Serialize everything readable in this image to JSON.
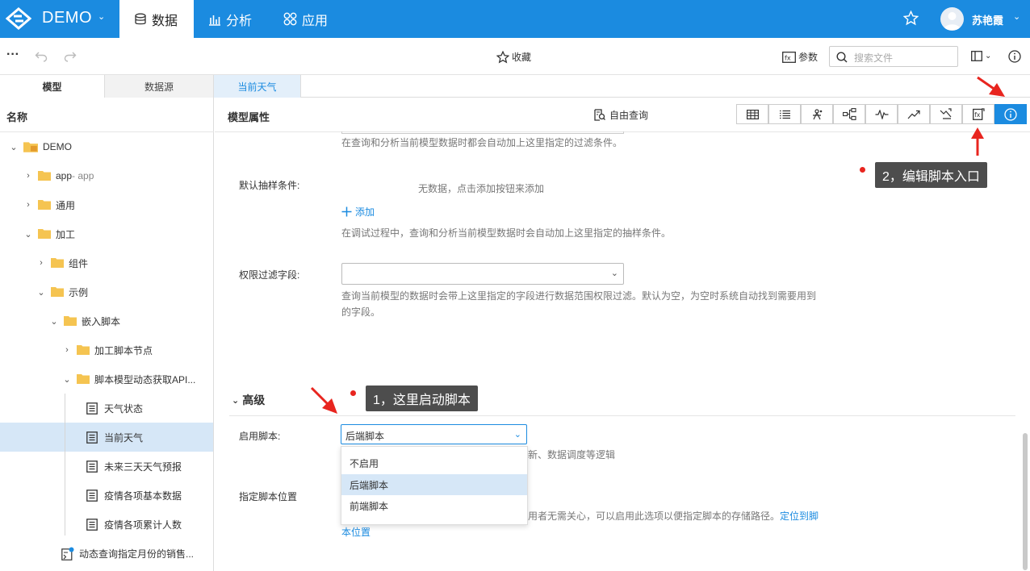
{
  "topbar": {
    "brand": "DEMO",
    "tabs": [
      {
        "label": "数据",
        "icon": "database-icon",
        "active": true
      },
      {
        "label": "分析",
        "icon": "bar-chart-icon",
        "active": false
      },
      {
        "label": "应用",
        "icon": "apps-icon",
        "active": false
      }
    ],
    "username": "苏艳霞",
    "accent": "#1b8be0"
  },
  "toolbar": {
    "favorite_label": "收藏",
    "params_label": "参数",
    "search_placeholder": "搜索文件"
  },
  "tabs": [
    {
      "label": "模型",
      "active": true
    },
    {
      "label": "数据源",
      "active": false
    },
    {
      "label": "当前天气",
      "active": false,
      "open": true
    }
  ],
  "sidebar": {
    "header": "名称",
    "tree": [
      {
        "label": "DEMO",
        "type": "root",
        "expanded": true
      },
      {
        "label": "app",
        "suffix": " - app",
        "type": "folder",
        "expanded": false
      },
      {
        "label": "通用",
        "type": "folder",
        "expanded": false
      },
      {
        "label": "加工",
        "type": "folder",
        "expanded": true
      },
      {
        "label": "组件",
        "type": "folder",
        "expanded": false
      },
      {
        "label": "示例",
        "type": "folder",
        "expanded": true
      },
      {
        "label": "嵌入脚本",
        "type": "folder",
        "expanded": true
      },
      {
        "label": "加工脚本节点",
        "type": "folder",
        "expanded": false
      },
      {
        "label": "脚本模型动态获取API...",
        "type": "folder",
        "expanded": true
      },
      {
        "label": "天气状态",
        "type": "doc"
      },
      {
        "label": "当前天气",
        "type": "doc",
        "selected": true
      },
      {
        "label": "未来三天天气预报",
        "type": "doc"
      },
      {
        "label": "疫情各项基本数据",
        "type": "doc"
      },
      {
        "label": "疫情各项累计人数",
        "type": "doc"
      },
      {
        "label": "动态查询指定月份的销售...",
        "type": "model"
      }
    ]
  },
  "main": {
    "title": "模型属性",
    "free_query": "自由查询",
    "filter_hint": "在查询和分析当前模型数据时都会自动加上这里指定的过滤条件。",
    "sampling_label": "默认抽样条件:",
    "sampling_empty": "无数据，点击添加按钮来添加",
    "add_label": "添加",
    "sampling_hint": "在调试过程中，查询和分析当前模型数据时会自动加上这里指定的抽样条件。",
    "perm_label": "权限过滤字段:",
    "perm_hint_1": "查询当前模型的数据时会带上这里指定的字段进行数据范围权限过滤。默认为空，为空时系统自动找到需要用到",
    "perm_hint_2": "的字段。",
    "advanced_label": "高级",
    "enable_script_label": "启用脚本:",
    "enable_script_value": "后端脚本",
    "script_hint_tail": "新、数据调度等逻辑",
    "script_location_label": "指定脚本位置",
    "location_hint_tail": "用者无需关心，可以启用此选项以便指定脚本的存储路径。",
    "location_link_1": "定位到脚",
    "location_link_2": "本位置",
    "dropdown_options": [
      {
        "label": "不启用",
        "highlighted": false
      },
      {
        "label": "后端脚本",
        "highlighted": true
      },
      {
        "label": "前端脚本",
        "highlighted": false
      }
    ]
  },
  "annotations": {
    "tip1": "1，这里启动脚本",
    "tip2": "2，编辑脚本入口",
    "color": "#e8251f"
  }
}
